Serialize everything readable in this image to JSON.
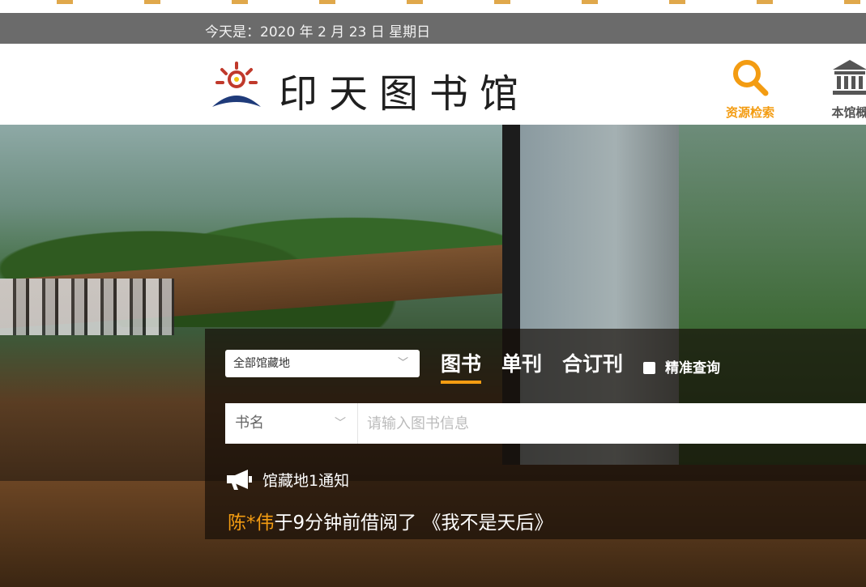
{
  "topbar": {
    "date_text": "今天是：2020 年 2 月 23 日 星期日"
  },
  "header": {
    "title": "印天图书馆",
    "nav": [
      {
        "label": "资源检索",
        "icon": "search-icon"
      },
      {
        "label": "本馆概",
        "icon": "library-building-icon"
      }
    ]
  },
  "search": {
    "location_select": "全部馆藏地",
    "tabs": [
      "图书",
      "单刊",
      "合订刊"
    ],
    "active_tab": "图书",
    "exact_label": "精准查询",
    "field_select": "书名",
    "placeholder": "请输入图书信息",
    "value": ""
  },
  "notice": {
    "title": "馆藏地1通知",
    "name": "陈*伟",
    "text": "于9分钟前借阅了 《我不是天后》"
  },
  "colors": {
    "accent": "#f39c12",
    "date_bar": "#6b6b6b"
  }
}
